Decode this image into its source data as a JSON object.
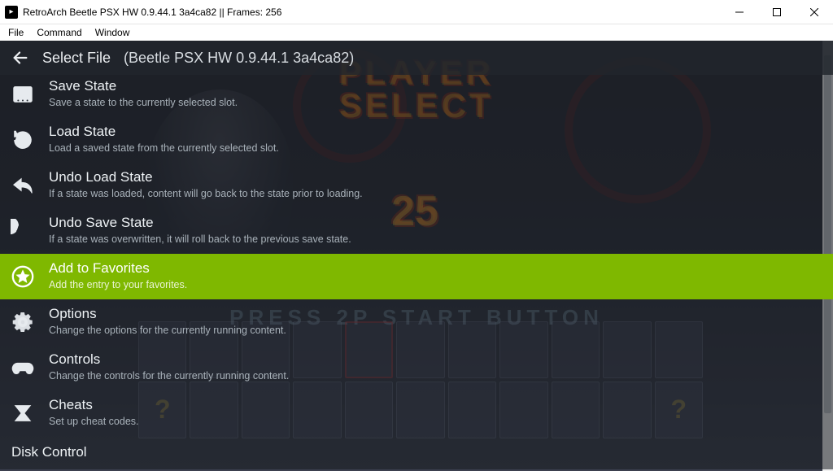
{
  "window": {
    "title": "RetroArch Beetle PSX HW 0.9.44.1 3a4ca82 || Frames: 256"
  },
  "menubar": {
    "file": "File",
    "command": "Command",
    "window": "Window"
  },
  "header": {
    "select_file": "Select File",
    "subtitle": "(Beetle PSX HW 0.9.44.1 3a4ca82)"
  },
  "game_bg": {
    "player_select_line1": "PLAYER",
    "player_select_line2": "SELECT",
    "timer": "25",
    "press": "PRESS  2P  START  BUTTON"
  },
  "menu": [
    {
      "id": "save-state",
      "title": "Save State",
      "desc": "Save a state to the currently selected slot."
    },
    {
      "id": "load-state",
      "title": "Load State",
      "desc": "Load a saved state from the currently selected slot."
    },
    {
      "id": "undo-load",
      "title": "Undo Load State",
      "desc": "If a state was loaded, content will go back to the state prior to loading."
    },
    {
      "id": "undo-save",
      "title": "Undo Save State",
      "desc": "If a state was overwritten, it will roll back to the previous save state."
    },
    {
      "id": "add-fav",
      "title": "Add to Favorites",
      "desc": "Add the entry to your favorites."
    },
    {
      "id": "options",
      "title": "Options",
      "desc": "Change the options for the currently running content."
    },
    {
      "id": "controls",
      "title": "Controls",
      "desc": "Change the controls for the currently running content."
    },
    {
      "id": "cheats",
      "title": "Cheats",
      "desc": "Set up cheat codes."
    },
    {
      "id": "disk",
      "title": "Disk Control",
      "desc": ""
    }
  ],
  "selected_index": 4
}
